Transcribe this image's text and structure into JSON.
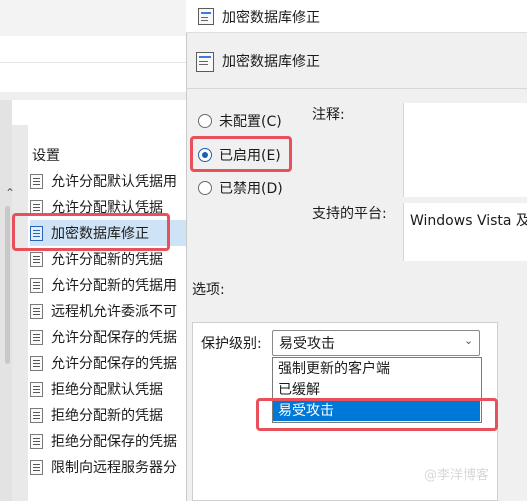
{
  "window": {
    "title": "加密数据库修正"
  },
  "header": {
    "title": "加密数据库修正"
  },
  "state_radios": [
    {
      "label": "未配置(C)",
      "checked": false
    },
    {
      "label": "已启用(E)",
      "checked": true
    },
    {
      "label": "已禁用(D)",
      "checked": false
    }
  ],
  "labels": {
    "comment": "注释:",
    "supported_on": "支持的平台:",
    "options": "选项:",
    "protection_level": "保护级别:"
  },
  "supported_on_value": "Windows Vista 及",
  "combo": {
    "value": "易受攻击"
  },
  "dropdown_options": [
    {
      "label": "强制更新的客户端",
      "selected": false
    },
    {
      "label": "已缓解",
      "selected": false
    },
    {
      "label": "易受攻击",
      "selected": true
    }
  ],
  "settings_panel": {
    "header": "设置",
    "items": [
      {
        "label": "允许分配默认凭据用"
      },
      {
        "label": "允许分配默认凭据"
      },
      {
        "label": "加密数据库修正"
      },
      {
        "label": "允许分配新的凭据"
      },
      {
        "label": "允许分配新的凭据用"
      },
      {
        "label": "远程机允许委派不可"
      },
      {
        "label": "允许分配保存的凭据"
      },
      {
        "label": "允许分配保存的凭据"
      },
      {
        "label": "拒绝分配默认凭据"
      },
      {
        "label": "拒绝分配新的凭据"
      },
      {
        "label": "拒绝分配保存的凭据"
      },
      {
        "label": "限制向远程服务器分"
      }
    ]
  },
  "watermark": "@李洋博客",
  "colors": {
    "highlight_border": "#e8505b",
    "selected_bg": "#0078d7",
    "radio_accent": "#1a5fb4"
  }
}
